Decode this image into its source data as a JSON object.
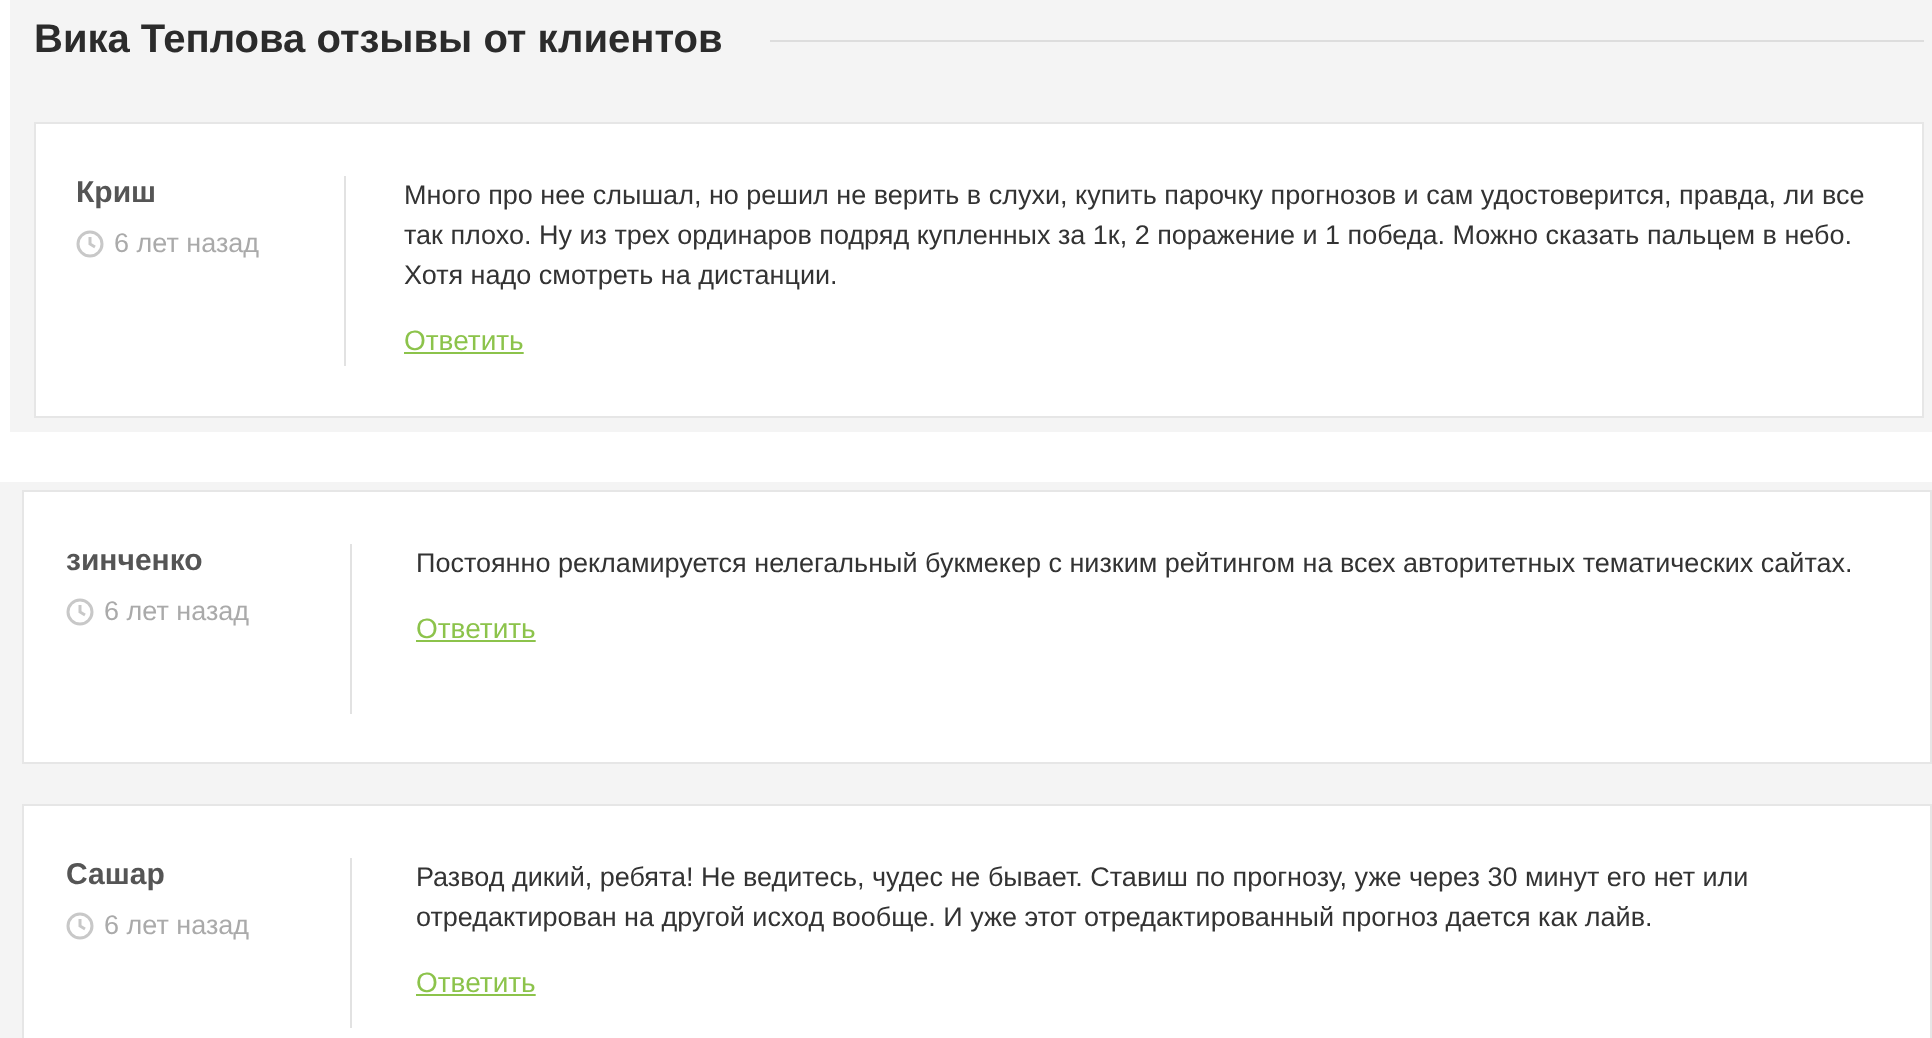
{
  "title": "Вика Теплова отзывы от клиентов",
  "reviews": [
    {
      "author": "Криш",
      "time": "6 лет назад",
      "text": "Много про нее слышал, но решил не верить в слухи, купить парочку прогнозов и сам удостоверится, правда, ли все так плохо. Ну из трех ординаров подряд купленных за 1к, 2 поражение и 1 победа. Можно сказать пальцем в небо. Хотя надо смотреть на дистанции.",
      "reply": "Ответить"
    },
    {
      "author": "зинченко",
      "time": "6 лет назад",
      "text": "Постоянно рекламируется нелегальный букмекер с низким рейтингом на всех авторитетных тематических сайтах.",
      "reply": "Ответить"
    },
    {
      "author": "Сашар",
      "time": "6 лет назад",
      "text": "Развод дикий, ребята! Не ведитесь, чудес не бывает. Ставиш по прогнозу, уже через 30 минут его нет или отредактирован на другой исход вообще. И уже этот отредактированный прогноз дается как лайв.",
      "reply": "Ответить"
    }
  ]
}
